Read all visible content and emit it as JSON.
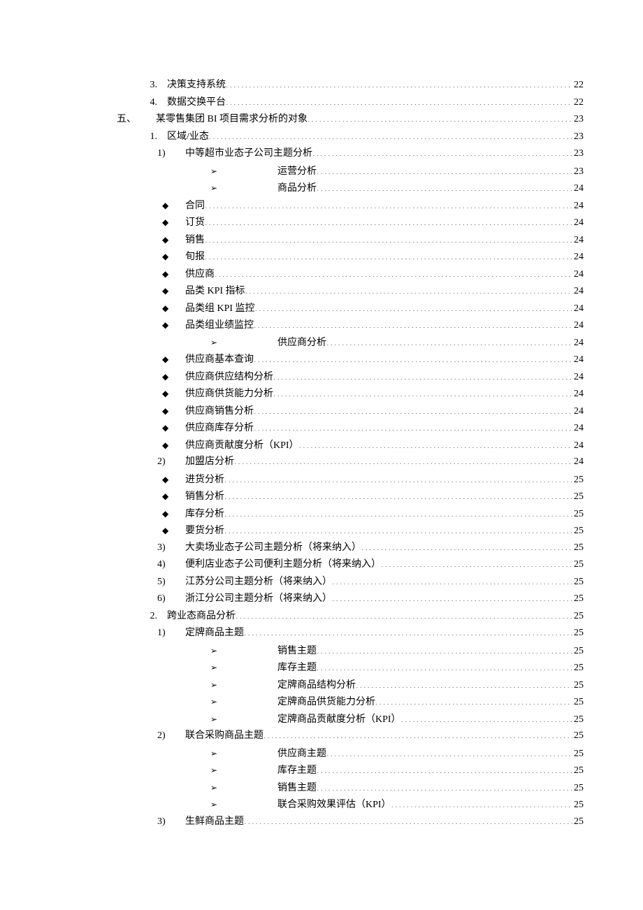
{
  "toc": [
    {
      "level": "num",
      "marker": "3.",
      "label": "决策支持系统",
      "page": "22"
    },
    {
      "level": "num",
      "marker": "4.",
      "label": "数据交换平台",
      "page": "22"
    },
    {
      "level": "top",
      "marker": "五、",
      "label": "某零售集团 BI 项目需求分析的对象",
      "page": "23"
    },
    {
      "level": "num",
      "marker": "1.",
      "label": "区域/业态",
      "page": "23"
    },
    {
      "level": "paren",
      "marker": "1)",
      "label": "中等超市业态子公司主题分析",
      "page": "23"
    },
    {
      "level": "arrow",
      "marker": "➢",
      "label": "运营分析",
      "page": "23"
    },
    {
      "level": "arrow",
      "marker": "➢",
      "label": "商品分析",
      "page": "24"
    },
    {
      "level": "dia",
      "marker": "◆",
      "label": "合同",
      "page": "24"
    },
    {
      "level": "dia",
      "marker": "◆",
      "label": "订货",
      "page": "24"
    },
    {
      "level": "dia",
      "marker": "◆",
      "label": "销售",
      "page": "24"
    },
    {
      "level": "dia",
      "marker": "◆",
      "label": "旬报",
      "page": "24"
    },
    {
      "level": "dia",
      "marker": "◆",
      "label": "供应商",
      "page": "24"
    },
    {
      "level": "dia",
      "marker": "◆",
      "label": "品类 KPI 指标",
      "page": "24"
    },
    {
      "level": "dia",
      "marker": "◆",
      "label": "品类组 KPI 监控",
      "page": "24"
    },
    {
      "level": "dia",
      "marker": "◆",
      "label": "品类组业绩监控",
      "page": "24"
    },
    {
      "level": "arrow",
      "marker": "➢",
      "label": "供应商分析",
      "page": "24"
    },
    {
      "level": "dia",
      "marker": "◆",
      "label": "供应商基本查询",
      "page": "24"
    },
    {
      "level": "dia",
      "marker": "◆",
      "label": "供应商供应结构分析",
      "page": "24"
    },
    {
      "level": "dia",
      "marker": "◆",
      "label": "供应商供货能力分析",
      "page": "24"
    },
    {
      "level": "dia",
      "marker": "◆",
      "label": "供应商销售分析",
      "page": "24"
    },
    {
      "level": "dia",
      "marker": "◆",
      "label": "供应商库存分析",
      "page": "24"
    },
    {
      "level": "dia",
      "marker": "◆",
      "label": "供应商贡献度分析（KPI）",
      "page": "24"
    },
    {
      "level": "paren",
      "marker": "2)",
      "label": "加盟店分析",
      "page": "24"
    },
    {
      "level": "dia",
      "marker": "◆",
      "label": "进货分析",
      "page": "25"
    },
    {
      "level": "dia",
      "marker": "◆",
      "label": "销售分析",
      "page": "25"
    },
    {
      "level": "dia",
      "marker": "◆",
      "label": "库存分析",
      "page": "25"
    },
    {
      "level": "dia",
      "marker": "◆",
      "label": "要货分析",
      "page": "25"
    },
    {
      "level": "paren",
      "marker": "3)",
      "label": "大卖场业态子公司主题分析（将来纳入）",
      "page": "25"
    },
    {
      "level": "paren",
      "marker": "4)",
      "label": "便利店业态子公司便利主题分析（将来纳入）",
      "page": "25"
    },
    {
      "level": "paren",
      "marker": "5)",
      "label": "江苏分公司主题分析（将来纳入）",
      "page": "25"
    },
    {
      "level": "paren",
      "marker": "6)",
      "label": "浙江分公司主题分析（将来纳入）",
      "page": "25"
    },
    {
      "level": "num",
      "marker": "2.",
      "label": "跨业态商品分析",
      "page": "25"
    },
    {
      "level": "paren",
      "marker": "1)",
      "label": "定牌商品主题",
      "page": "25"
    },
    {
      "level": "arrow",
      "marker": "➢",
      "label": "销售主题",
      "page": "25"
    },
    {
      "level": "arrow",
      "marker": "➢",
      "label": "库存主题",
      "page": "25"
    },
    {
      "level": "arrow",
      "marker": "➢",
      "label": "定牌商品结构分析",
      "page": "25"
    },
    {
      "level": "arrow",
      "marker": "➢",
      "label": "定牌商品供货能力分析",
      "page": "25"
    },
    {
      "level": "arrow",
      "marker": "➢",
      "label": "定牌商品贡献度分析（KPI）",
      "page": "25"
    },
    {
      "level": "paren",
      "marker": "2)",
      "label": "联合采购商品主题",
      "page": "25"
    },
    {
      "level": "arrow",
      "marker": "➢",
      "label": "供应商主题",
      "page": "25"
    },
    {
      "level": "arrow",
      "marker": "➢",
      "label": "库存主题",
      "page": "25"
    },
    {
      "level": "arrow",
      "marker": "➢",
      "label": "销售主题",
      "page": "25"
    },
    {
      "level": "arrow",
      "marker": "➢",
      "label": "联合采购效果评估（KPI）",
      "page": "25"
    },
    {
      "level": "paren",
      "marker": "3)",
      "label": "生鲜商品主题",
      "page": "25"
    }
  ]
}
